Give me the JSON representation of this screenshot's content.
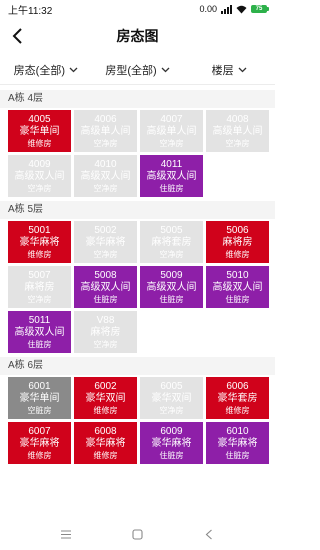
{
  "status_bar": {
    "time": "上午11:32",
    "network_speed": "0.00",
    "battery": "75"
  },
  "header": {
    "title": "房态图"
  },
  "filters": [
    {
      "label": "房态(全部)"
    },
    {
      "label": "房型(全部)"
    },
    {
      "label": "楼层"
    }
  ],
  "floors": [
    {
      "label": "A栋 4层",
      "rooms": [
        {
          "number": "4005",
          "type": "豪华单间",
          "status": "维修房",
          "state": "repair"
        },
        {
          "number": "4006",
          "type": "高级单人间",
          "status": "空净房",
          "state": "vacant"
        },
        {
          "number": "4007",
          "type": "高级单人间",
          "status": "空净房",
          "state": "vacant"
        },
        {
          "number": "4008",
          "type": "高级单人间",
          "status": "空净房",
          "state": "vacant"
        },
        {
          "number": "4009",
          "type": "高级双人间",
          "status": "空净房",
          "state": "vacant"
        },
        {
          "number": "4010",
          "type": "高级双人间",
          "status": "空净房",
          "state": "vacant"
        },
        {
          "number": "4011",
          "type": "高级双人间",
          "status": "住脏房",
          "state": "dirty"
        }
      ]
    },
    {
      "label": "A栋 5层",
      "rooms": [
        {
          "number": "5001",
          "type": "豪华麻将",
          "status": "维修房",
          "state": "repair"
        },
        {
          "number": "5002",
          "type": "豪华麻将",
          "status": "空净房",
          "state": "vacant"
        },
        {
          "number": "5005",
          "type": "麻将套房",
          "status": "空净房",
          "state": "vacant"
        },
        {
          "number": "5006",
          "type": "麻将房",
          "status": "维修房",
          "state": "repair"
        },
        {
          "number": "5007",
          "type": "麻将房",
          "status": "空净房",
          "state": "vacant"
        },
        {
          "number": "5008",
          "type": "高级双人间",
          "status": "住脏房",
          "state": "dirty"
        },
        {
          "number": "5009",
          "type": "高级双人间",
          "status": "住脏房",
          "state": "dirty"
        },
        {
          "number": "5010",
          "type": "高级双人间",
          "status": "住脏房",
          "state": "dirty"
        },
        {
          "number": "5011",
          "type": "高级双人间",
          "status": "住脏房",
          "state": "dirty"
        },
        {
          "number": "V88",
          "type": "麻将房",
          "status": "空净房",
          "state": "vacant"
        }
      ]
    },
    {
      "label": "A栋 6层",
      "rooms": [
        {
          "number": "6001",
          "type": "豪华单间",
          "status": "空脏房",
          "state": "free"
        },
        {
          "number": "6002",
          "type": "豪华双间",
          "status": "维修房",
          "state": "repair"
        },
        {
          "number": "6005",
          "type": "豪华双间",
          "status": "空净房",
          "state": "vacant"
        },
        {
          "number": "6006",
          "type": "豪华套房",
          "status": "维修房",
          "state": "repair"
        },
        {
          "number": "6007",
          "type": "豪华麻将",
          "status": "维修房",
          "state": "repair"
        },
        {
          "number": "6008",
          "type": "豪华麻将",
          "status": "维修房",
          "state": "repair"
        },
        {
          "number": "6009",
          "type": "豪华麻将",
          "status": "住脏房",
          "state": "dirty"
        },
        {
          "number": "6010",
          "type": "豪华麻将",
          "status": "住脏房",
          "state": "dirty"
        }
      ]
    }
  ],
  "colors": {
    "repair": "#d0021b",
    "vacant": "#e3e3e3",
    "dirty": "#8e1fa8",
    "free": "#8a8a8a"
  }
}
